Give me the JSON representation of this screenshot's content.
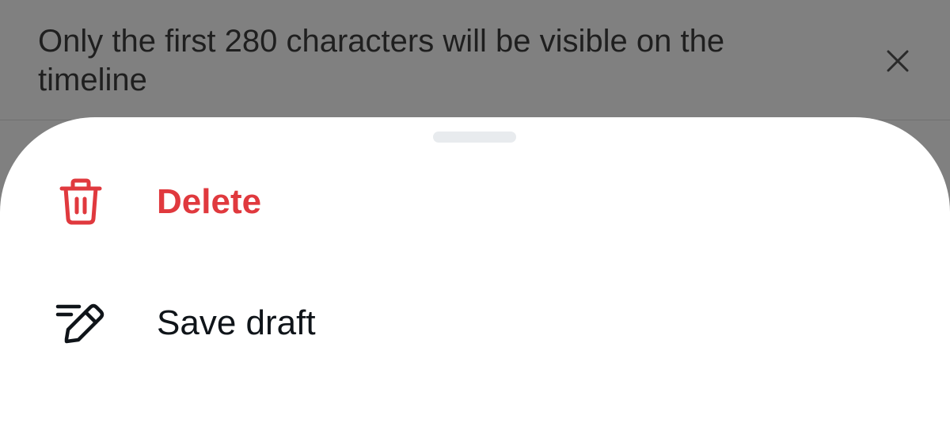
{
  "banner": {
    "message": "Only the first 280 characters will be visible on the timeline",
    "close_icon": "close-icon"
  },
  "sheet": {
    "menu": [
      {
        "label": "Delete",
        "icon": "trash-icon",
        "color": "#e0393e"
      },
      {
        "label": "Save draft",
        "icon": "pencil-draft-icon",
        "color": "#0f1419"
      }
    ]
  },
  "colors": {
    "overlay": "#808080",
    "sheet_bg": "#ffffff",
    "destructive": "#e0393e",
    "text_primary": "#0f1419",
    "grabber": "#e8ebee"
  }
}
